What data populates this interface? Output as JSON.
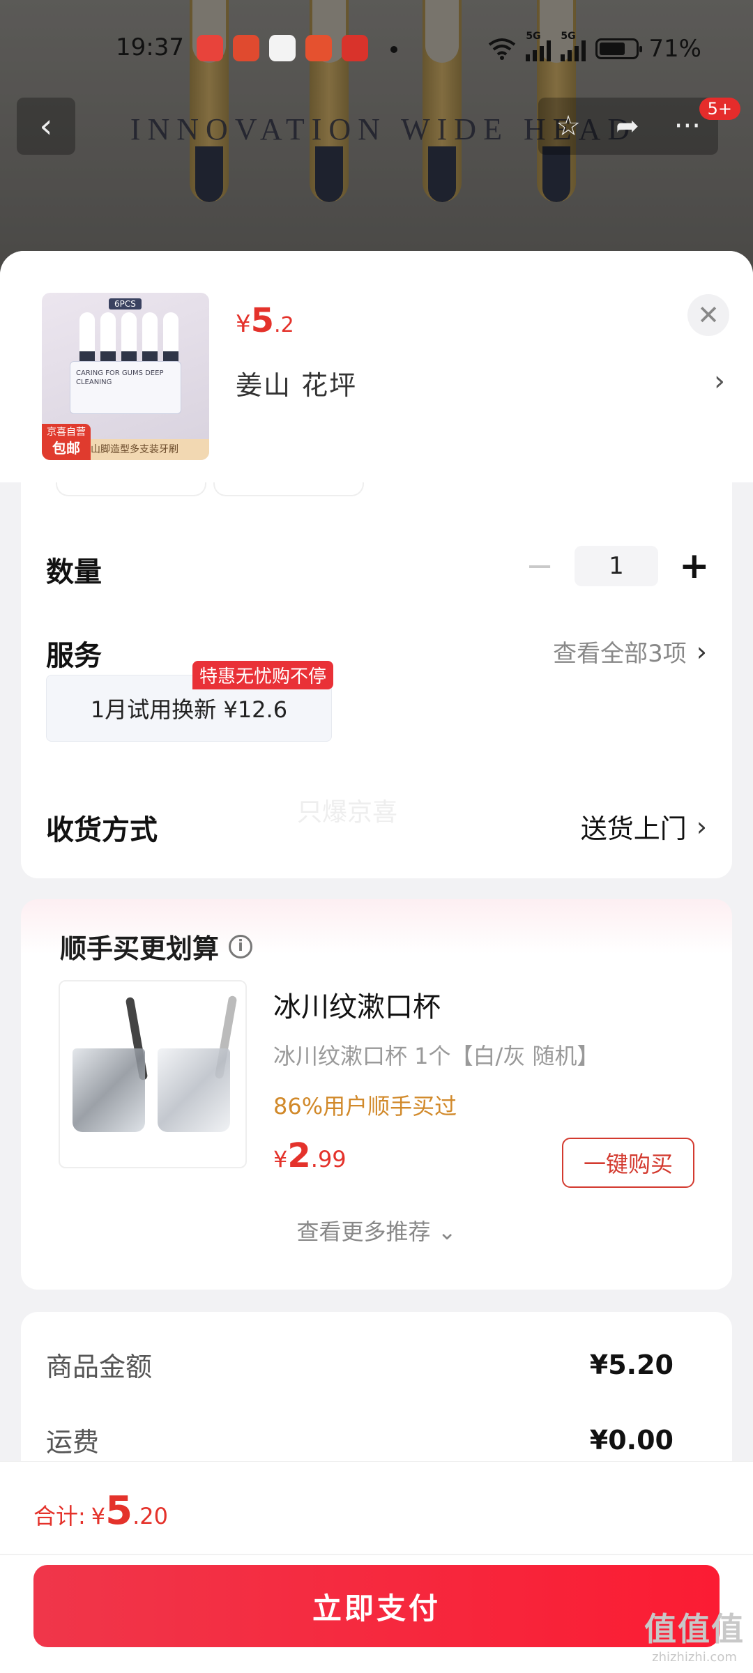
{
  "status": {
    "time": "19:37",
    "battery": "71%",
    "battery_level": 0.71,
    "network": "5G"
  },
  "hero": {
    "banner": "INNOVATION WIDE HEAD",
    "badge": "5+"
  },
  "sheet": {
    "price": {
      "currency": "¥",
      "int": "5",
      "dec": ".2"
    },
    "address": "姜山  花坪",
    "thumb_label": "山脚造型多支装牙刷",
    "thumb_pack": "6PCS",
    "thumb_card_text": "CARING FOR GUMS DEEP CLEANING",
    "thumb_tag_top": "京喜自营",
    "thumb_tag_bottom": "包邮"
  },
  "options": {
    "qty_label": "数量",
    "qty_value": "1",
    "service_label": "服务",
    "service_right": "查看全部3项",
    "service_chip": "1月试用换新  ¥12.6",
    "service_tag": "特惠无忧购不停",
    "delivery_label": "收货方式",
    "delivery_value": "送货上门",
    "watermark": "只爆京喜"
  },
  "addon": {
    "title": "顺手买更划算",
    "name": "冰川纹漱口杯",
    "desc": "冰川纹漱口杯 1个【白/灰 随机】",
    "hint": "86%用户顺手买过",
    "price": {
      "currency": "¥",
      "int": "2",
      "dec": ".99"
    },
    "buy_label": "一键购买",
    "more_label": "查看更多推荐"
  },
  "totals": {
    "goods_label": "商品金额",
    "goods_value": "¥5.20",
    "shipping_label": "运费",
    "shipping_value": "¥0.00"
  },
  "footer": {
    "sum_label": "合计:",
    "sum": {
      "currency": "¥",
      "int": "5",
      "dec": ".20"
    },
    "pay_label": "立即支付",
    "site_big": "值值值",
    "site_small": "zhizhizhi.com"
  },
  "icons": {
    "back": "chevron-left-icon",
    "star": "star-icon",
    "share": "share-icon",
    "more": "more-icon",
    "close": "close-icon",
    "info": "info-icon"
  },
  "colors": {
    "accent_red": "#e4322b",
    "hint_orange": "#d1892a",
    "pay_gradient_start": "#f0364a",
    "pay_gradient_end": "#fb1c33"
  }
}
